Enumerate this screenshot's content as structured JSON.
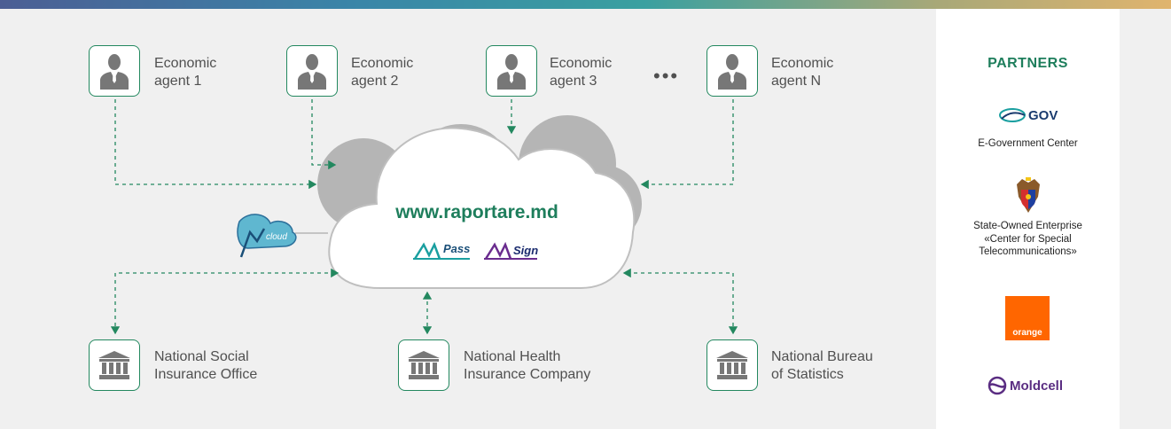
{
  "agents": [
    {
      "label": "Economic\nagent  1"
    },
    {
      "label": "Economic\nagent  2"
    },
    {
      "label": "Economic\nagent  3"
    },
    {
      "label": "Economic\nagent  N"
    }
  ],
  "ellipsis": "•••",
  "cloud": {
    "title": "www.raportare.md",
    "mpass": "Pass",
    "msign": "Sign",
    "mcloud": "cloud"
  },
  "institutions": [
    {
      "label": "National Social\nInsurance Office"
    },
    {
      "label": "National Health\nInsurance Company"
    },
    {
      "label": "National Bureau\nof Statistics"
    }
  ],
  "partners": {
    "title": "PARTNERS",
    "items": [
      {
        "name": "E-Government Center",
        "logo_text": "GOV"
      },
      {
        "name": "State-Owned Enterprise\n«Center for Special\nTelecommunications»"
      },
      {
        "name": "",
        "logo_text": "orange"
      },
      {
        "name": "",
        "logo_text": "Moldcell"
      }
    ]
  },
  "colors": {
    "accent": "#23885f",
    "cloud_dark": "#b5b5b5",
    "cloud_light": "#ffffff",
    "orange": "#ff6600",
    "moldcell": "#5a2d82"
  }
}
